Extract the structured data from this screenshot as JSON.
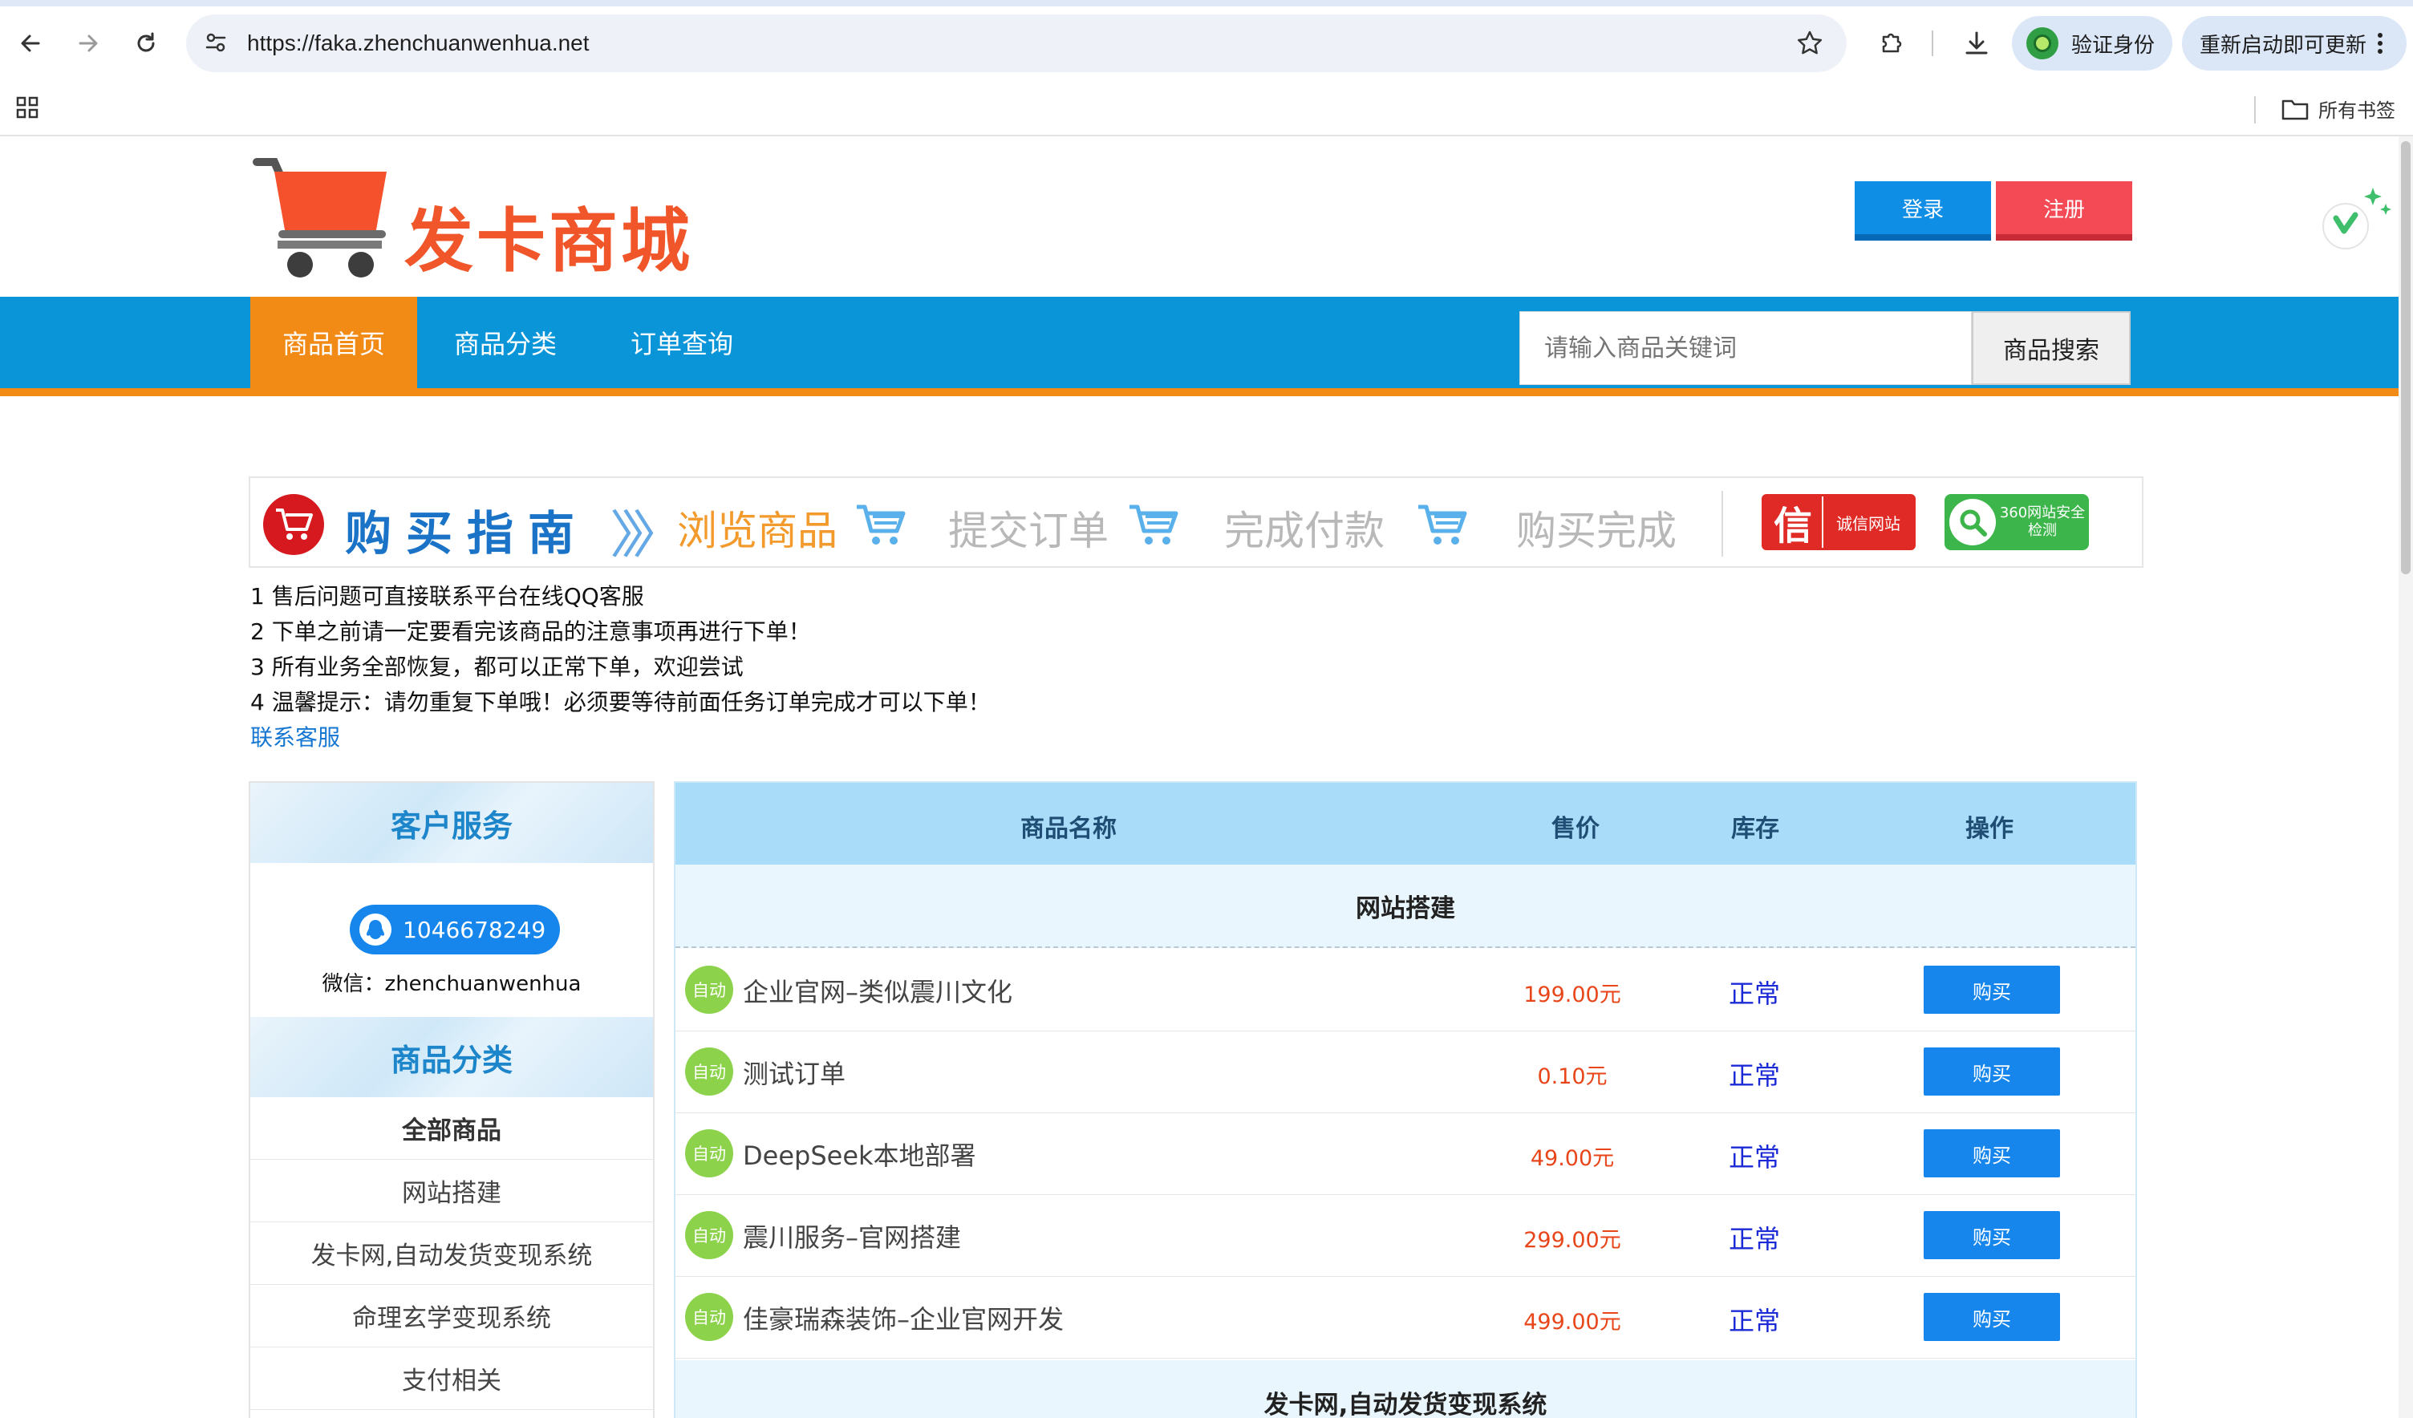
{
  "browser": {
    "url": "https://faka.zhenchuanwenhua.net",
    "verify_label": "验证身份",
    "update_label": "重新启动即可更新",
    "bookmarks_folder": "所有书签"
  },
  "header": {
    "logo_text": "发卡商城",
    "login_label": "登录",
    "register_label": "注册"
  },
  "nav": {
    "items": [
      {
        "label": "商品首页"
      },
      {
        "label": "商品分类"
      },
      {
        "label": "订单查询"
      }
    ],
    "search_placeholder": "请输入商品关键词",
    "search_button": "商品搜索"
  },
  "guide": {
    "title": "购买指南",
    "steps": [
      "浏览商品",
      "提交订单",
      "完成付款",
      "购买完成"
    ],
    "badge_chengxin": "诚信网站",
    "badge_xin": "信",
    "badge_360": "360网站安全检测"
  },
  "notices": [
    "1 售后问题可直接联系平台在线QQ客服",
    "2 下单之前请一定要看完该商品的注意事项再进行下单！",
    "3 所有业务全部恢复，都可以正常下单，欢迎尝试",
    "4 温馨提示：请勿重复下单哦！必须要等待前面任务订单完成才可以下单！"
  ],
  "contact_link": "联系客服",
  "sidebar": {
    "service_title": "客户服务",
    "qq": "1046678249",
    "wechat": "微信：zhenchuanwenhua",
    "category_title": "商品分类",
    "categories": [
      "全部商品",
      "网站搭建",
      "发卡网,自动发货变现系统",
      "命理玄学变现系统",
      "支付相关"
    ]
  },
  "table": {
    "headers": {
      "name": "商品名称",
      "price": "售价",
      "stock": "库存",
      "action": "操作"
    },
    "groups": [
      {
        "name": "网站搭建",
        "products": [
          {
            "badge": "自动",
            "name": "企业官网–类似震川文化",
            "price": "199.00元",
            "stock": "正常",
            "action": "购买"
          },
          {
            "badge": "自动",
            "name": "测试订单",
            "price": "0.10元",
            "stock": "正常",
            "action": "购买"
          },
          {
            "badge": "自动",
            "name": "DeepSeek本地部署",
            "price": "49.00元",
            "stock": "正常",
            "action": "购买"
          },
          {
            "badge": "自动",
            "name": "震川服务–官网搭建",
            "price": "299.00元",
            "stock": "正常",
            "action": "购买"
          },
          {
            "badge": "自动",
            "name": "佳豪瑞森装饰–企业官网开发",
            "price": "499.00元",
            "stock": "正常",
            "action": "购买"
          }
        ]
      },
      {
        "name": "发卡网,自动发货变现系统",
        "products": []
      }
    ]
  }
}
